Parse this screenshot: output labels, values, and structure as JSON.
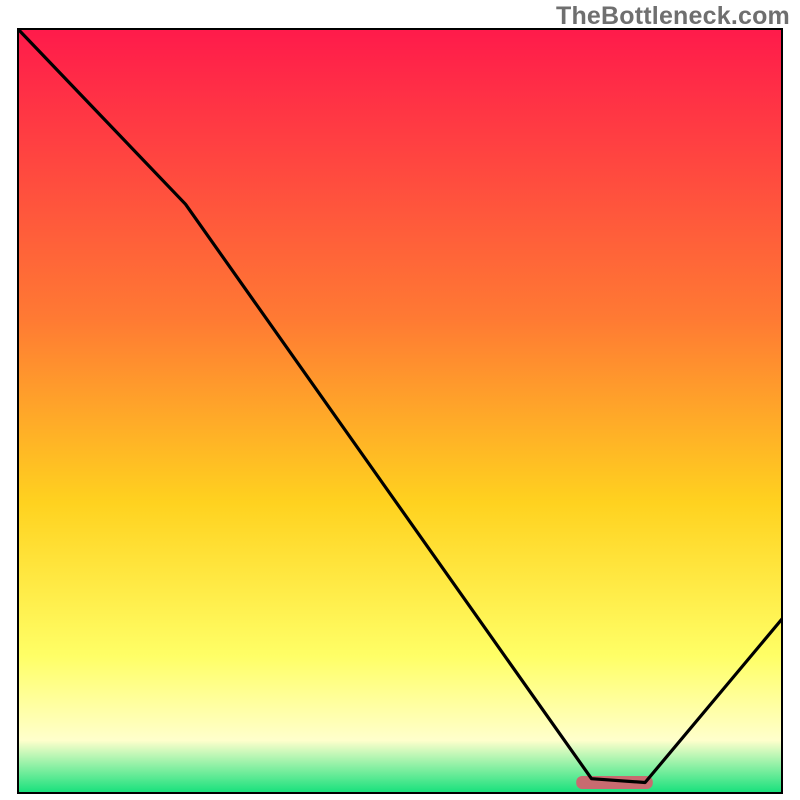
{
  "watermark": "TheBottleneck.com",
  "colors": {
    "top": "#ff1a4b",
    "mid1": "#ff7a33",
    "mid2": "#ffd21f",
    "mid3": "#ffff66",
    "mid4": "#ffffcc",
    "bottom": "#11e07a",
    "marker": "#c86b70",
    "line": "#000000",
    "border": "#000000"
  },
  "chart_data": {
    "type": "line",
    "title": "",
    "xlabel": "",
    "ylabel": "",
    "xlim": [
      0,
      100
    ],
    "ylim": [
      0,
      100
    ],
    "grid": false,
    "series": [
      {
        "name": "bottleneck-curve",
        "x": [
          0,
          22,
          75,
          82,
          100
        ],
        "y": [
          100,
          77,
          2,
          1.5,
          23
        ]
      }
    ],
    "annotations": [
      {
        "name": "optimal-marker",
        "shape": "rounded-bar",
        "x_range": [
          73,
          83
        ],
        "y": 1.5
      }
    ]
  }
}
